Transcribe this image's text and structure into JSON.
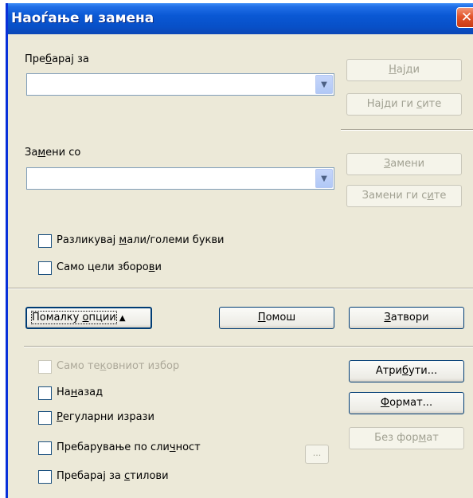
{
  "window": {
    "title": "Наоѓање и замена",
    "close_glyph": "✕"
  },
  "search": {
    "label_pre": "Пре",
    "label_u": "б",
    "label_post": "арај за",
    "value": ""
  },
  "replace": {
    "label_pre": "За",
    "label_u": "м",
    "label_post": "ени со",
    "value": ""
  },
  "buttons": {
    "find": {
      "pre": "",
      "u": "Н",
      "post": "ајди"
    },
    "find_all": {
      "pre": "Најди ги ",
      "u": "с",
      "post": "ите"
    },
    "replace": {
      "pre": "",
      "u": "З",
      "post": "амени"
    },
    "replace_all": {
      "pre": "Замени ги с",
      "u": "и",
      "post": "те"
    },
    "fewer_options": {
      "pre": "Помалку ",
      "u": "о",
      "post": "пции",
      "icon": "double-up-arrow-icon",
      "glyph": "▲"
    },
    "help": {
      "pre": "",
      "u": "П",
      "post": "омош"
    },
    "close": {
      "pre": "",
      "u": "З",
      "post": "атвори"
    },
    "attributes": {
      "pre": "Атри",
      "u": "б",
      "post": "ути..."
    },
    "format": {
      "pre": "",
      "u": "Ф",
      "post": "ормат..."
    },
    "no_format": {
      "pre": "Без фор",
      "u": "м",
      "post": "ат"
    },
    "similarity_options": {
      "label": "..."
    }
  },
  "checkboxes": {
    "match_case": {
      "pre": "Разликувај ",
      "u": "м",
      "post": "али/големи букви",
      "checked": false
    },
    "whole_words": {
      "pre": "Само цели зборо",
      "u": "в",
      "post": "и",
      "checked": false
    },
    "current_selection": {
      "pre": "Само те",
      "u": "к",
      "post": "овниот избор",
      "checked": false,
      "disabled": true
    },
    "backwards": {
      "pre": "На",
      "u": "н",
      "post": "азад",
      "checked": false
    },
    "regex": {
      "pre": "",
      "u": "Р",
      "post": "егуларни изрази",
      "checked": false
    },
    "similarity": {
      "pre": "Пребарување по сли",
      "u": "ч",
      "post": "ност",
      "checked": false
    },
    "styles": {
      "pre": "Пребарај за ",
      "u": "с",
      "post": "тилови",
      "checked": false
    }
  },
  "colors": {
    "titlebar": "#0a58d4",
    "dialog": "#ece9d8",
    "close": "#e2552b"
  }
}
